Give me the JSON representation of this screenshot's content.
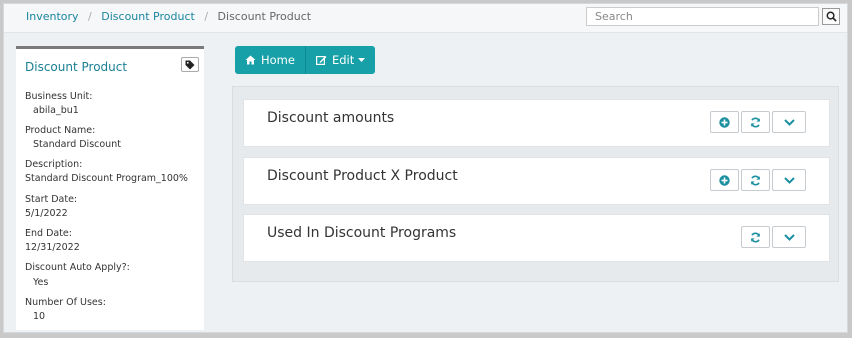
{
  "breadcrumb": {
    "items": [
      "Inventory",
      "Discount Product"
    ],
    "current": "Discount Product"
  },
  "search": {
    "placeholder": "Search"
  },
  "sidebar": {
    "title": "Discount Product",
    "fields": [
      {
        "label": "Business Unit:",
        "value": "abila_bu1"
      },
      {
        "label": "Product Name:",
        "value": "Standard Discount"
      },
      {
        "label": "Description:",
        "value": "Standard Discount Program_100%"
      },
      {
        "label": "Start Date:",
        "value": "5/1/2022"
      },
      {
        "label": "End Date:",
        "value": "12/31/2022"
      },
      {
        "label": "Discount Auto Apply?:",
        "value": "Yes"
      },
      {
        "label": "Number Of Uses:",
        "value": "10"
      }
    ]
  },
  "toolbar": {
    "home_label": "Home",
    "edit_label": "Edit"
  },
  "panels": [
    {
      "title": "Discount amounts"
    },
    {
      "title": "Discount Product X Product"
    },
    {
      "title": "Used In Discount Programs"
    }
  ],
  "colors": {
    "accent": "#17a0a8",
    "link": "#1a85a0",
    "icon": "#1a8fa0"
  }
}
